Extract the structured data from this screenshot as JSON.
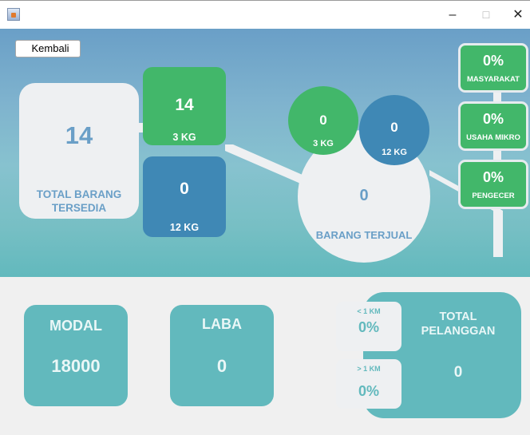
{
  "window": {
    "minimize": "–",
    "maximize": "☐",
    "close": "✕"
  },
  "back_button": {
    "label": "Kembali"
  },
  "stock": {
    "value": "14",
    "label": "TOTAL BARANG TERSEDIA"
  },
  "stock_tiles": [
    {
      "value": "14",
      "unit": "3 KG",
      "color": "#42b76a"
    },
    {
      "value": "0",
      "unit": "12 KG",
      "color": "#3f88b5"
    }
  ],
  "sold": {
    "value": "0",
    "label": "BARANG TERJUAL",
    "circles": [
      {
        "value": "0",
        "unit": "3 KG",
        "color": "#42b76a"
      },
      {
        "value": "0",
        "unit": "12 KG",
        "color": "#3f88b5"
      }
    ]
  },
  "segments": [
    {
      "percent": "0%",
      "label": "MASYARAKAT"
    },
    {
      "percent": "0%",
      "label": "USAHA MIKRO"
    },
    {
      "percent": "0%",
      "label": "PENGECER"
    }
  ],
  "modal": {
    "label": "MODAL",
    "value": "18000"
  },
  "laba": {
    "label": "LABA",
    "value": "0"
  },
  "pelanggan": {
    "label": "TOTAL PELANGGAN",
    "value": "0",
    "near": {
      "distance": "< 1 KM",
      "percent": "0%"
    },
    "far": {
      "distance": "> 1 KM",
      "percent": "0%"
    }
  },
  "colors": {
    "green": "#42b76a",
    "blue": "#3f88b5",
    "teal": "#62b9bd",
    "panel_light": "#eef0f2",
    "text_blue": "#6a9fc7"
  }
}
